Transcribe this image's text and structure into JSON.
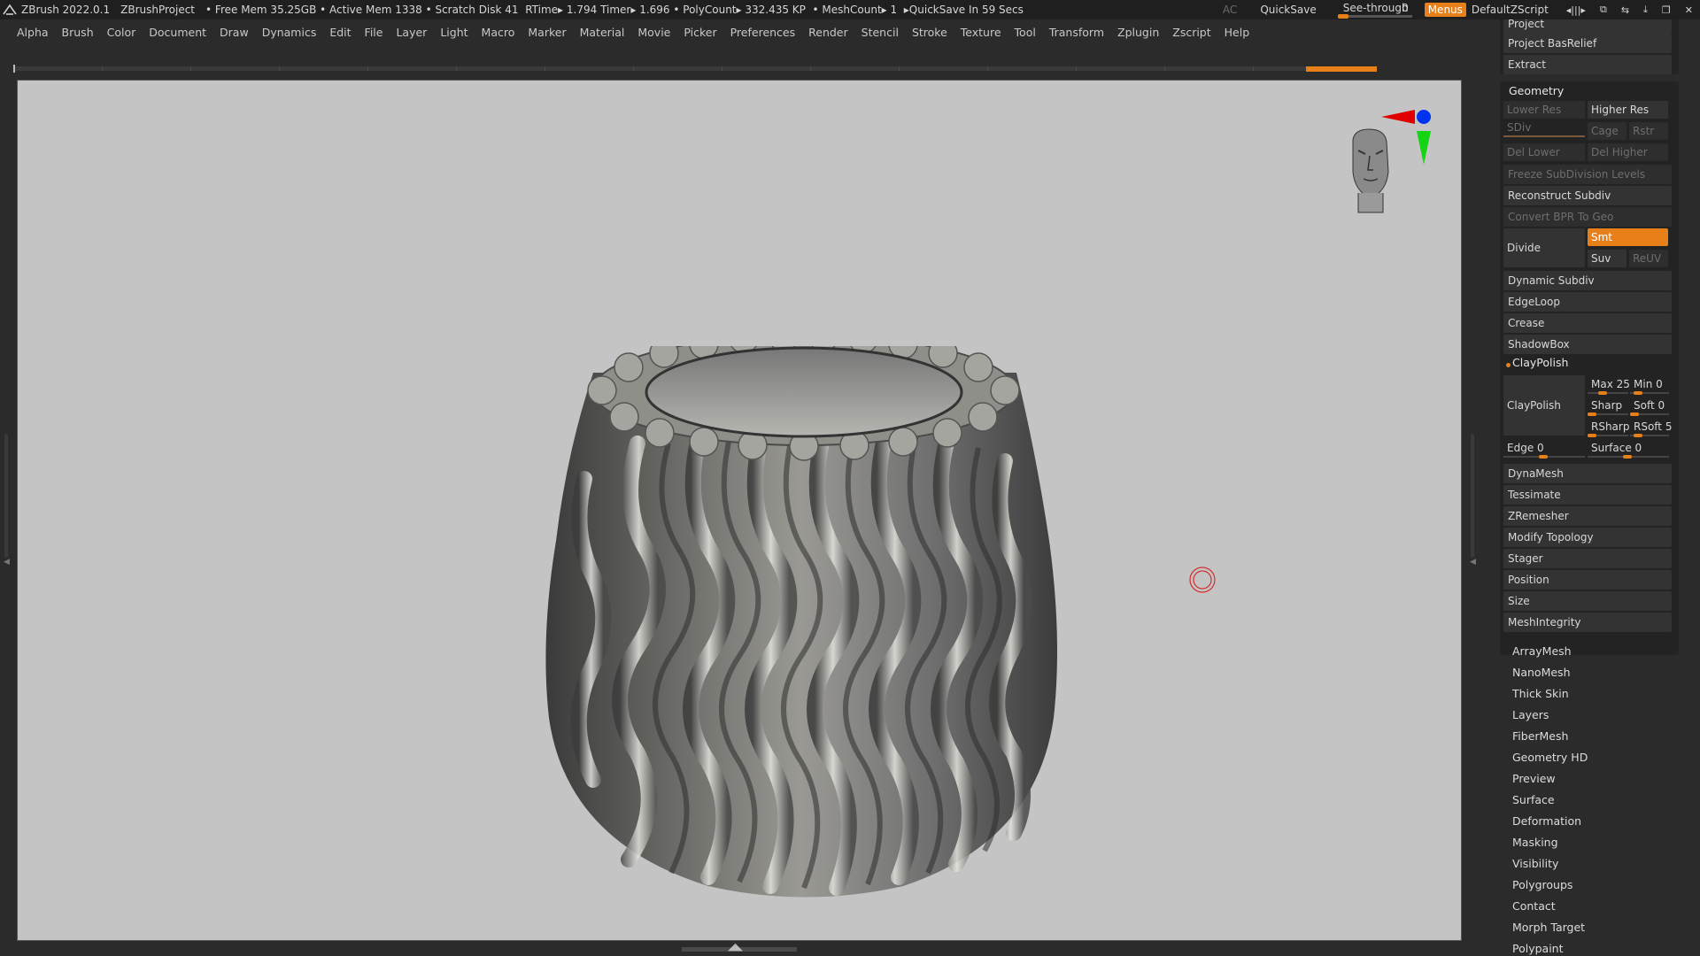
{
  "app": {
    "name": "ZBrush 2022.0.1",
    "project": "ZBrushProject",
    "status": {
      "free_mem": "• Free Mem 35.25GB",
      "active_mem": "• Active Mem 1338",
      "scratch": "• Scratch Disk 41",
      "rtime": "RTime▸ 1.794",
      "timer": "Timer▸ 1.696",
      "polycount": "• PolyCount▸ 332.435 KP",
      "meshcount": "• MeshCount▸ 1",
      "quicksave": "▸QuickSave In 59 Secs"
    },
    "ac": "AC",
    "quicksave_btn": "QuickSave",
    "seethrough_label": "See-through",
    "seethrough_value": "0",
    "menus_btn": "Menus",
    "script": "DefaultZScript"
  },
  "menubar": [
    "Alpha",
    "Brush",
    "Color",
    "Document",
    "Draw",
    "Dynamics",
    "Edit",
    "File",
    "Layer",
    "Light",
    "Macro",
    "Marker",
    "Material",
    "Movie",
    "Picker",
    "Preferences",
    "Render",
    "Stencil",
    "Stroke",
    "Texture",
    "Tool",
    "Transform",
    "Zplugin",
    "Zscript",
    "Help"
  ],
  "tray": {
    "top_rows": [
      "Project",
      "Project BasRelief",
      "Extract"
    ],
    "geometry": {
      "title": "Geometry",
      "lower_res": "Lower Res",
      "higher_res": "Higher Res",
      "sdiv": "SDiv",
      "cage": "Cage",
      "rstr": "Rstr",
      "del_lower": "Del Lower",
      "del_higher": "Del Higher",
      "freeze": "Freeze SubDivision Levels",
      "reconstruct": "Reconstruct Subdiv",
      "convert_bpr": "Convert BPR To Geo",
      "divide": "Divide",
      "smt": "Smt",
      "suv": "Suv",
      "reuv": "ReUV",
      "dynamic_subdiv": "Dynamic Subdiv",
      "edgeloop": "EdgeLoop",
      "crease": "Crease",
      "shadowbox": "ShadowBox",
      "claypolish_header": "ClayPolish",
      "claypolish_btn": "ClayPolish",
      "max": "Max 25",
      "min": "Min 0",
      "sharp": "Sharp",
      "soft": "Soft 0",
      "rsharp": "RSharp",
      "rsoft": "RSoft 5",
      "edge": "Edge 0",
      "surface": "Surface 0",
      "dynamesh": "DynaMesh",
      "tessimate": "Tessimate",
      "zremesher": "ZRemesher",
      "modify_topology": "Modify Topology",
      "stager": "Stager",
      "position": "Position",
      "size": "Size",
      "meshintegrity": "MeshIntegrity"
    },
    "subpalettes": [
      "ArrayMesh",
      "NanoMesh",
      "Thick Skin",
      "Layers",
      "FiberMesh",
      "Geometry HD",
      "Preview",
      "Surface",
      "Deformation",
      "Masking",
      "Visibility",
      "Polygroups",
      "Contact",
      "Morph Target",
      "Polypaint"
    ]
  },
  "colors": {
    "accent": "#e8801a",
    "viewport_bg": "#c4c4c4",
    "ui_bg": "#2b2b2b"
  }
}
